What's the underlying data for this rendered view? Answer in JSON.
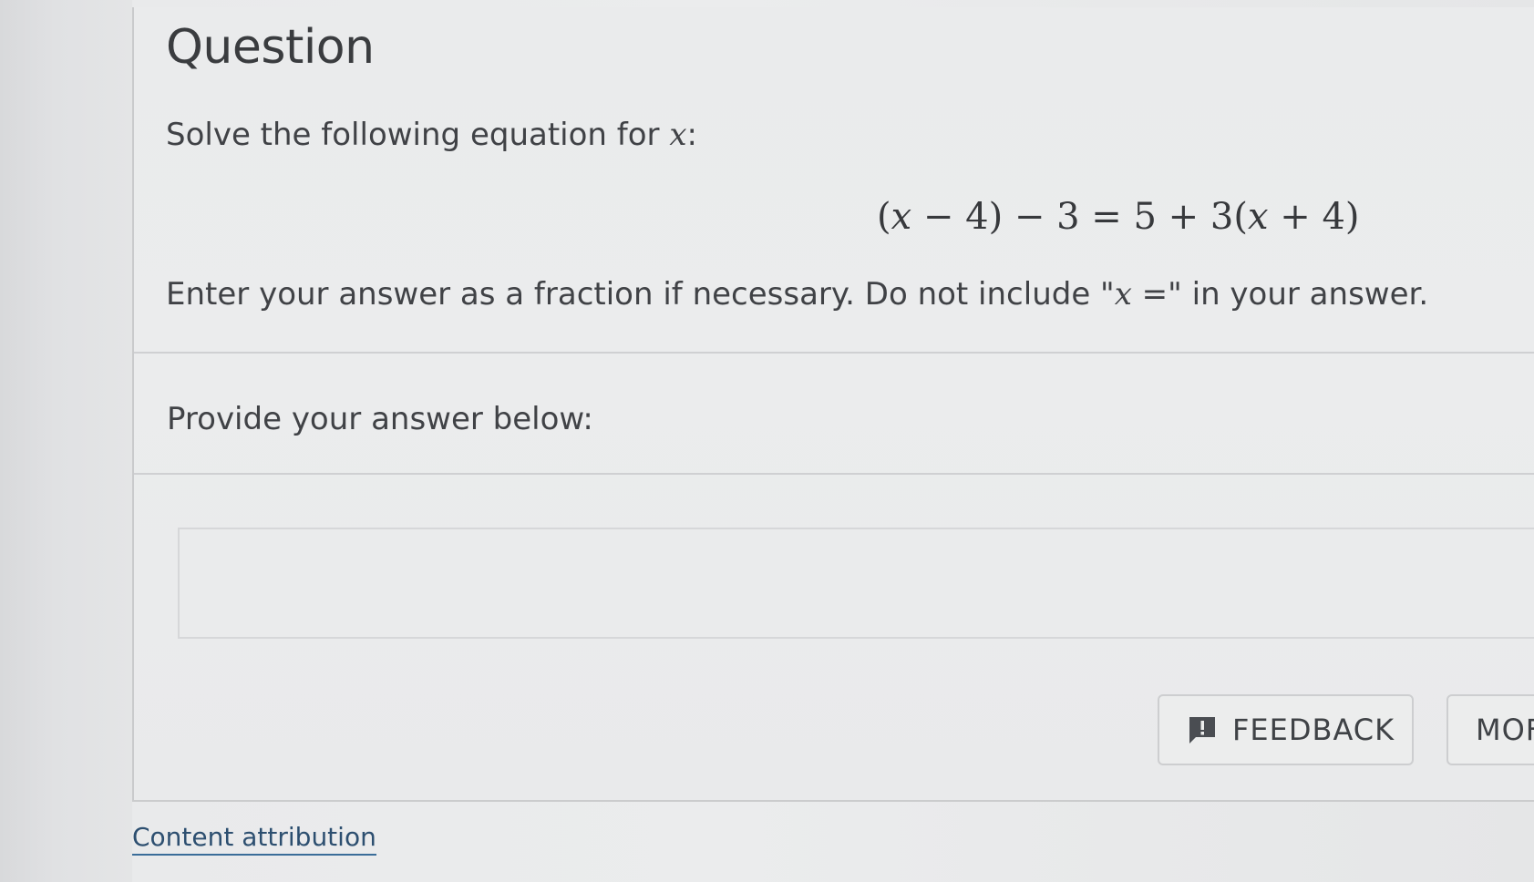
{
  "question": {
    "title": "Question",
    "prompt_prefix": "Solve the following equation for ",
    "prompt_var": "x",
    "prompt_suffix": ":",
    "equation": {
      "p1": "(",
      "v1": "x",
      "p2": " − 4) − 3 = 5 + 3(",
      "v2": "x",
      "p3": " + 4)"
    },
    "instructions_prefix": "Enter your answer as a fraction if necessary. Do not include \"",
    "instructions_var": "x",
    "instructions_mid": " =",
    "instructions_suffix": "\" in your answer."
  },
  "answer": {
    "label": "Provide your answer below:",
    "input_value": "",
    "input_placeholder": ""
  },
  "buttons": {
    "feedback_label": "FEEDBACK",
    "more_label": "MOF"
  },
  "footer": {
    "attribution_label": "Content attribution"
  },
  "icons": {
    "feedback": "feedback-icon"
  },
  "colors": {
    "link": "#2d4f70",
    "text": "#404246",
    "icon": "#4a4d52"
  }
}
